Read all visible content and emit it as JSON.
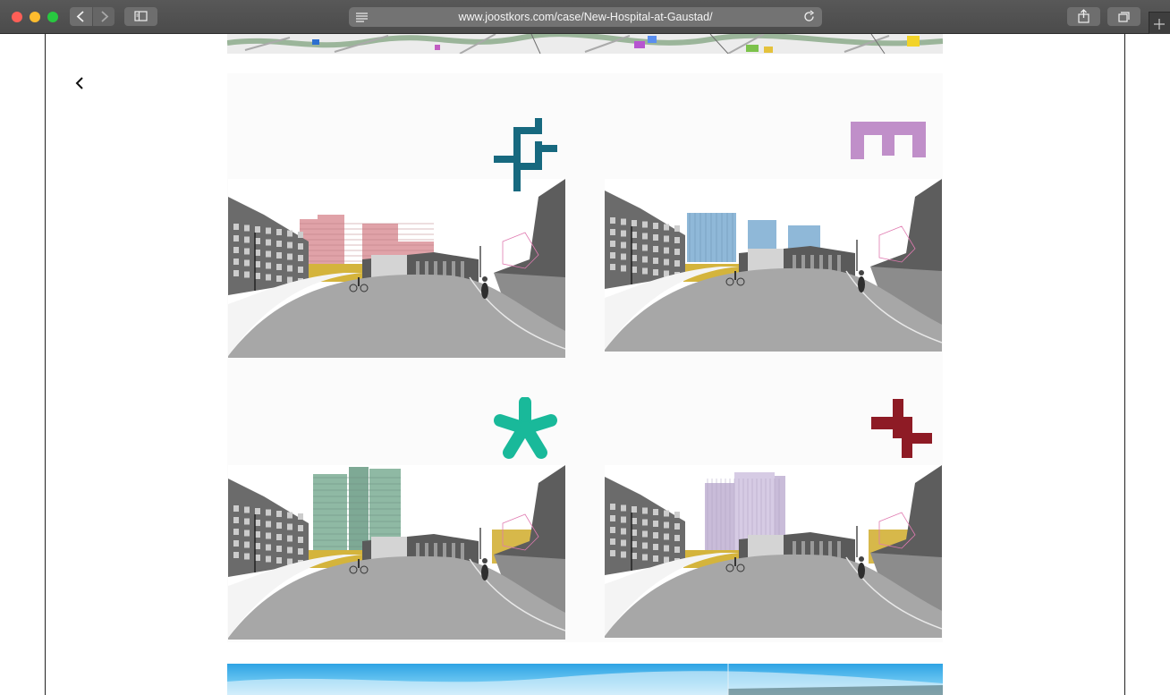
{
  "browser": {
    "url": "www.joostkors.com/case/New-Hospital-at-Gaustad/",
    "traffic_lights": {
      "close": "#fe5f57",
      "minimize": "#febc2e",
      "zoom": "#28c840"
    },
    "icons": [
      "back-icon",
      "forward-icon",
      "sidebar-icon",
      "reader-icon",
      "reload-icon",
      "share-icon",
      "tabs-overview-icon",
      "new-tab-icon"
    ]
  },
  "page": {
    "back_icon": "chevron-left-icon",
    "variants": [
      {
        "id": "variant-1",
        "symbol": "interlocking-cross",
        "color": "#17697f",
        "building_color": "#e0a2a8"
      },
      {
        "id": "variant-2",
        "symbol": "comb",
        "color": "#c08fc9",
        "building_color": "#8fb8d8"
      },
      {
        "id": "variant-3",
        "symbol": "asterisk",
        "color": "#19b99a",
        "building_color": "#8fb9a4"
      },
      {
        "id": "variant-4",
        "symbol": "stepped-cross",
        "color": "#8e1b25",
        "building_color": "#c9bcd9"
      }
    ]
  }
}
